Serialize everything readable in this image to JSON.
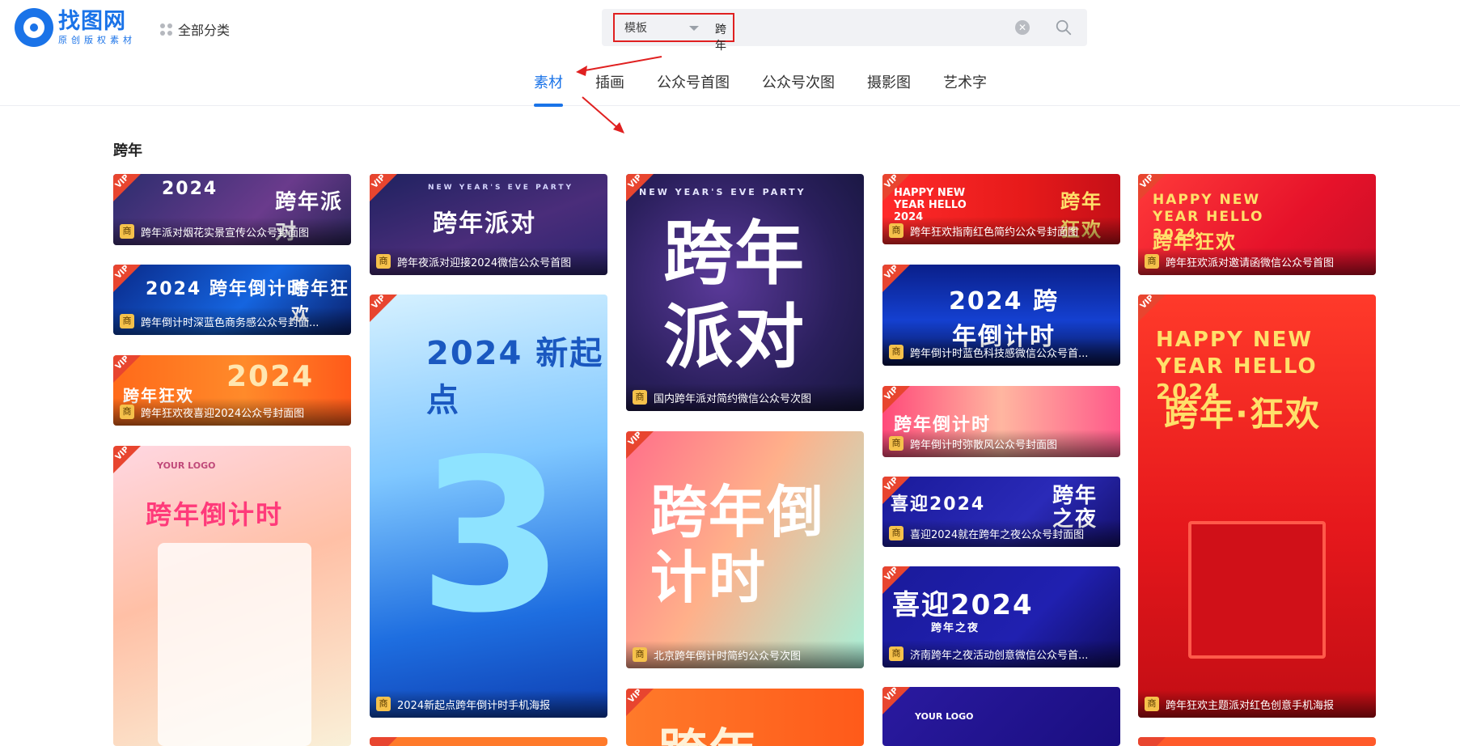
{
  "logo": {
    "name": "找图网",
    "sub": "原创版权素材"
  },
  "nav": {
    "all_categories": "全部分类"
  },
  "search": {
    "type": "模板",
    "keyword": "跨年",
    "placeholder": ""
  },
  "tabs": [
    "素材",
    "插画",
    "公众号首图",
    "公众号次图",
    "摄影图",
    "艺术字"
  ],
  "section_title": "跨年",
  "badges": {
    "vip": "VIP",
    "commercial": "商"
  },
  "cards": [
    {
      "title": "跨年派对烟花实景宣传公众号封面图",
      "art": "跨年派对",
      "sub": "2024"
    },
    {
      "title": "跨年倒计时深蓝色商务感公众号封面...",
      "art": "2024 跨年倒计时",
      "sub": "跨年狂欢"
    },
    {
      "title": "跨年狂欢夜喜迎2024公众号封面图",
      "art": "跨年狂欢",
      "sub": "2024"
    },
    {
      "title": "",
      "art": "跨年倒计时",
      "sub": "YOUR LOGO"
    },
    {
      "title": "跨年夜派对迎接2024微信公众号首图",
      "art": "跨年派对",
      "sub": "NEW YEAR'S EVE PARTY"
    },
    {
      "title": "2024新起点跨年倒计时手机海报",
      "art": "2024 新起点",
      "sub": "3"
    },
    {
      "title": "国内跨年派对简约微信公众号次图",
      "art": "跨年派对",
      "sub": "NEW YEAR'S EVE PARTY"
    },
    {
      "title": "北京跨年倒计时简约公众号次图",
      "art": "跨年倒计时",
      "sub": ""
    },
    {
      "title": "",
      "art": "跨年",
      "sub": ""
    },
    {
      "title": "跨年狂欢指南红色简约公众号封面图",
      "art": "跨年狂欢",
      "sub": "HAPPY NEW YEAR HELLO 2024"
    },
    {
      "title": "跨年倒计时蓝色科技感微信公众号首...",
      "art": "2024 跨年倒计时",
      "sub": ""
    },
    {
      "title": "跨年倒计时弥散风公众号封面图",
      "art": "跨年倒计时",
      "sub": ""
    },
    {
      "title": "喜迎2024就在跨年之夜公众号封面图",
      "art": "跨年之夜",
      "sub": "喜迎2024"
    },
    {
      "title": "济南跨年之夜活动创意微信公众号首...",
      "art": "喜迎2024",
      "sub": "跨年之夜"
    },
    {
      "title": "",
      "art": "YOUR LOGO",
      "sub": ""
    },
    {
      "title": "跨年狂欢派对邀请函微信公众号首图",
      "art": "HAPPY NEW YEAR HELLO 2024",
      "sub": "跨年狂欢"
    },
    {
      "title": "跨年狂欢主题派对红色创意手机海报",
      "art": "跨年·狂欢",
      "sub": "HAPPY NEW YEAR HELLO 2024"
    }
  ]
}
